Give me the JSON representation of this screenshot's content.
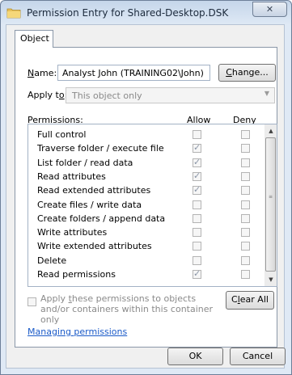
{
  "window": {
    "title": "Permission Entry for Shared-Desktop.DSK",
    "close_label": "✕"
  },
  "tabs": {
    "object": "Object"
  },
  "name": {
    "label_prefix": "N",
    "label_rest": "ame:",
    "value": "Analyst John (TRAINING02\\John)",
    "change_button_prefix": "C",
    "change_button_rest": "hange..."
  },
  "apply_to": {
    "label_prefix": "Apply t",
    "label_u": "o",
    "label_rest": ":",
    "value": "This object only"
  },
  "permissions": {
    "label_prefix": "P",
    "label_rest": "ermissions:",
    "allow_header": "Allow",
    "deny_header": "Deny",
    "rows": [
      {
        "label": "Full control",
        "allow": false,
        "deny": false
      },
      {
        "label": "Traverse folder / execute file",
        "allow": true,
        "deny": false
      },
      {
        "label": "List folder / read data",
        "allow": true,
        "deny": false
      },
      {
        "label": "Read attributes",
        "allow": true,
        "deny": false
      },
      {
        "label": "Read extended attributes",
        "allow": true,
        "deny": false
      },
      {
        "label": "Create files / write data",
        "allow": false,
        "deny": false
      },
      {
        "label": "Create folders / append data",
        "allow": false,
        "deny": false
      },
      {
        "label": "Write attributes",
        "allow": false,
        "deny": false
      },
      {
        "label": "Write extended attributes",
        "allow": false,
        "deny": false
      },
      {
        "label": "Delete",
        "allow": false,
        "deny": false
      },
      {
        "label": "Read permissions",
        "allow": true,
        "deny": false
      }
    ]
  },
  "apply_inherit": {
    "text_prefix": "Apply ",
    "text_u": "t",
    "text_rest": "hese permissions to objects and/or containers within this container only",
    "checked": false
  },
  "clear_all": {
    "prefix": "C",
    "u": "l",
    "rest": "ear All"
  },
  "footer": {
    "link": "Managing permissions",
    "ok": "OK",
    "cancel": "Cancel"
  }
}
